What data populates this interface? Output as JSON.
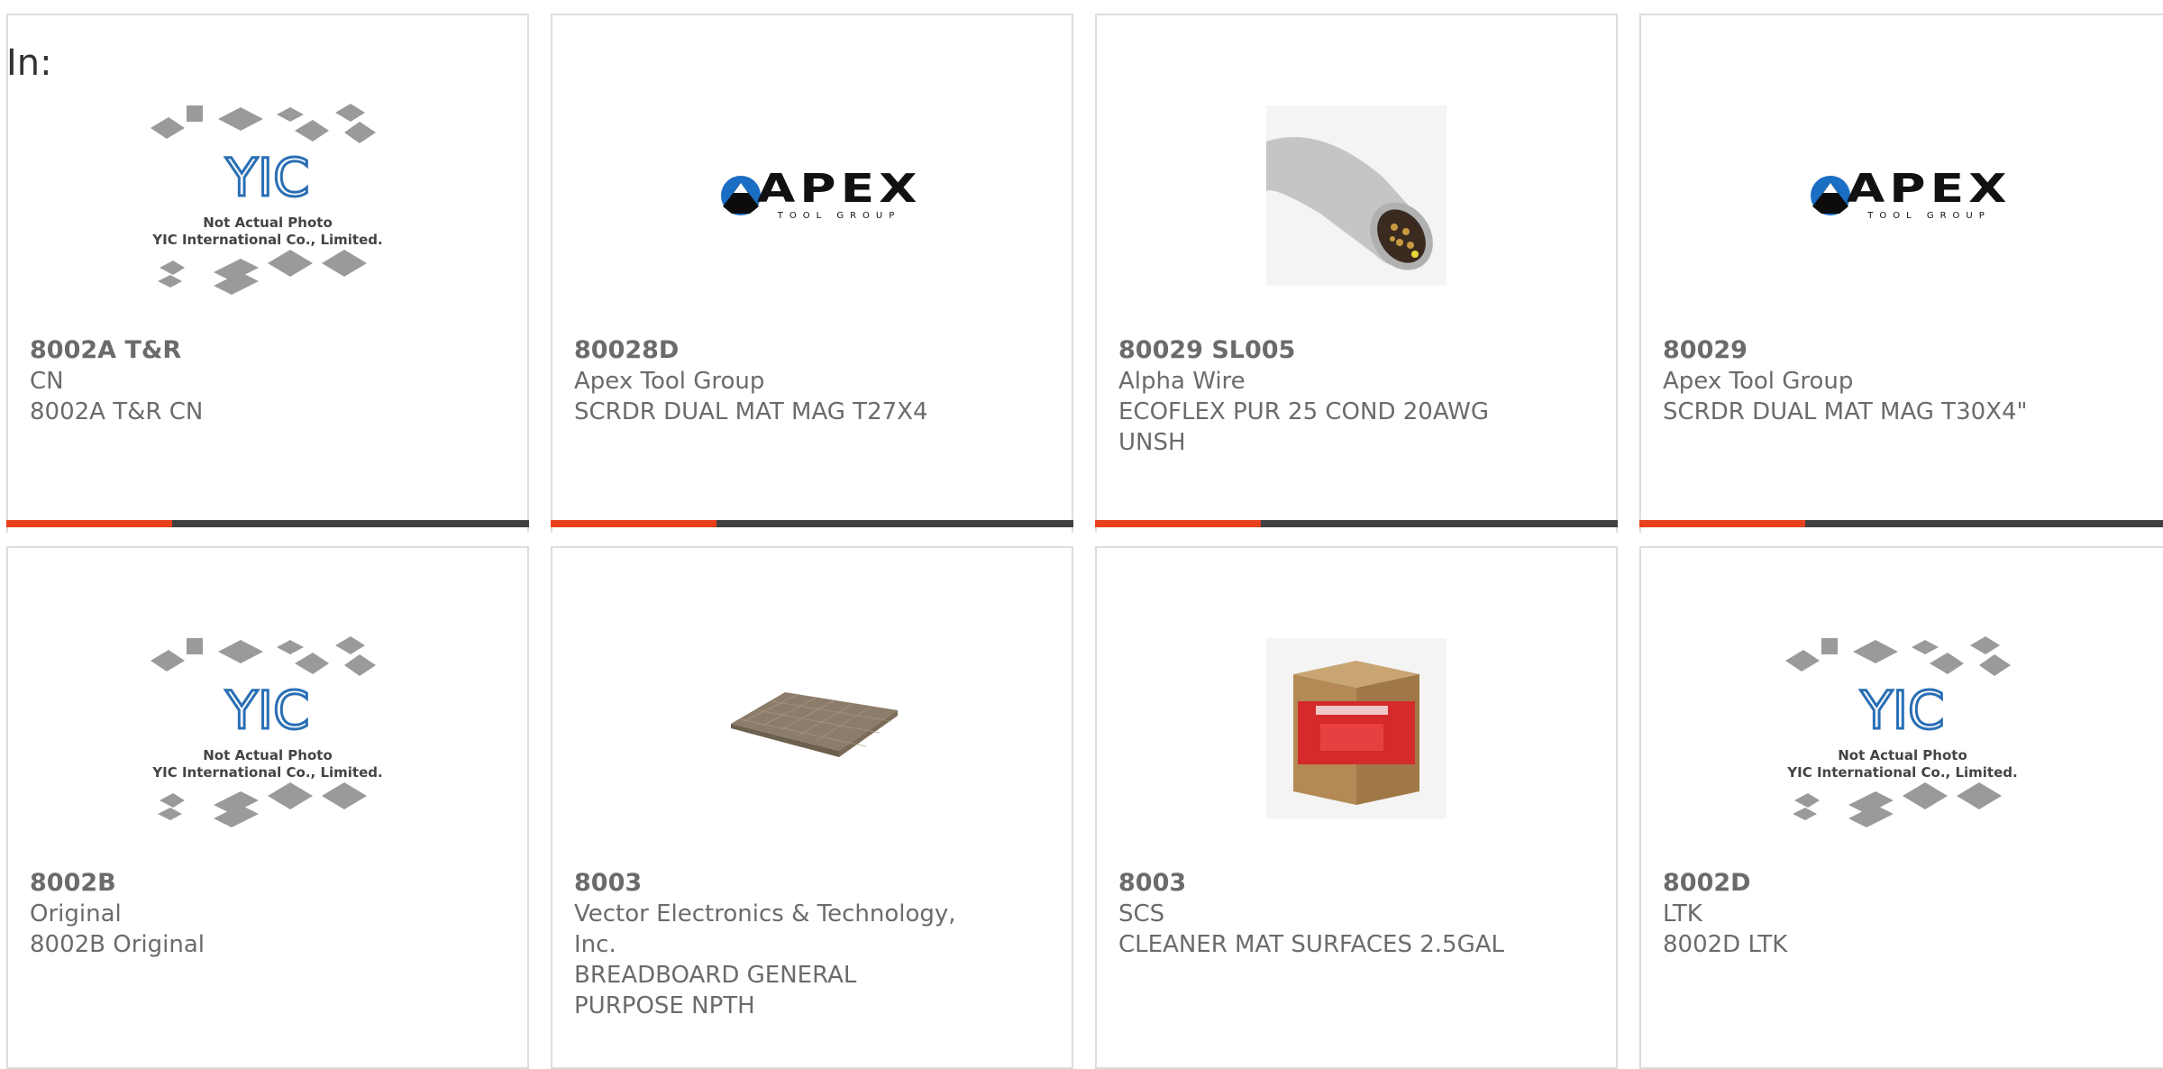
{
  "filter_label": "In:",
  "image_caption": {
    "line1": "Not Actual Photo",
    "line2": "YIC International Co., Limited.",
    "logo": "YIC"
  },
  "apex_logo": {
    "big": "APEX",
    "small": "TOOL GROUP"
  },
  "products": [
    {
      "part": "8002A T&R",
      "manufacturer": "CN",
      "description": "8002A T&R CN",
      "image": "yic-placeholder"
    },
    {
      "part": "80028D",
      "manufacturer": "Apex Tool Group",
      "description": "SCRDR DUAL MAT MAG T27X4",
      "image": "apex-logo"
    },
    {
      "part": "80029 SL005",
      "manufacturer": "Alpha Wire",
      "description": "ECOFLEX PUR 25 COND 20AWG UNSH",
      "image": "cable-photo"
    },
    {
      "part": "80029",
      "manufacturer": "Apex Tool Group",
      "description": "SCRDR DUAL MAT MAG T30X4\"",
      "image": "apex-logo"
    },
    {
      "part": "8002B",
      "manufacturer": "Original",
      "description": "8002B Original",
      "image": "yic-placeholder"
    },
    {
      "part": "8003",
      "manufacturer": "Vector Electronics & Technology, Inc.",
      "description": "BREADBOARD GENERAL PURPOSE NPTH",
      "image": "breadboard-photo"
    },
    {
      "part": "8003",
      "manufacturer": "SCS",
      "description": "CLEANER MAT SURFACES 2.5GAL",
      "image": "cleaner-box-photo"
    },
    {
      "part": "8002D",
      "manufacturer": "LTK",
      "description": "8002D LTK",
      "image": "yic-placeholder"
    }
  ],
  "colors": {
    "accent": "#e8401c",
    "bar": "#404040",
    "text": "#6b6b6b",
    "border": "#dddddd"
  }
}
